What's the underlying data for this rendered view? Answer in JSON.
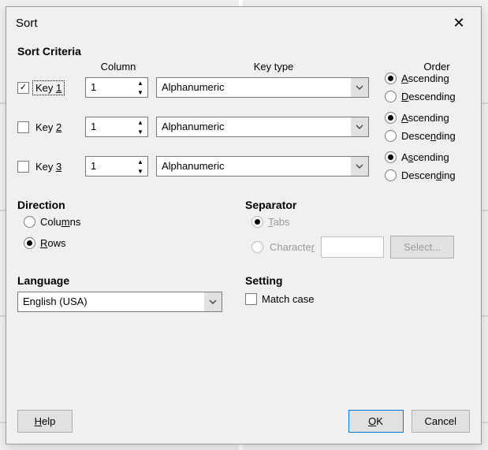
{
  "title": "Sort",
  "criteria": {
    "heading": "Sort Criteria",
    "headers": {
      "column": "Column",
      "keytype": "Key type",
      "order": "Order"
    },
    "keys": [
      {
        "label_pre": "Key ",
        "label_u": "1",
        "label_post": "",
        "checked": true,
        "column": "1",
        "keytype": "Alphanumeric"
      },
      {
        "label_pre": "Key ",
        "label_u": "2",
        "label_post": "",
        "checked": false,
        "column": "1",
        "keytype": "Alphanumeric"
      },
      {
        "label_pre": "Key ",
        "label_u": "3",
        "label_post": "",
        "checked": false,
        "column": "1",
        "keytype": "Alphanumeric"
      }
    ],
    "order": {
      "asc_pre": "",
      "asc_u": "A",
      "asc_post": "scending",
      "desc_pre": "",
      "desc_u": "D",
      "desc_post": "escending",
      "asc2_pre": "",
      "asc2_u": "A",
      "asc2_post": "scending",
      "desc2_pre": "Desce",
      "desc2_u": "n",
      "desc2_post": "ding",
      "asc3_pre": "A",
      "asc3_u": "s",
      "asc3_post": "cending",
      "desc3_pre": "Descen",
      "desc3_u": "d",
      "desc3_post": "ing"
    }
  },
  "direction": {
    "heading": "Direction",
    "columns_pre": "Colu",
    "columns_u": "m",
    "columns_post": "ns",
    "rows_pre": "",
    "rows_u": "R",
    "rows_post": "ows"
  },
  "separator": {
    "heading": "Separator",
    "tabs_pre": "",
    "tabs_u": "T",
    "tabs_post": "abs",
    "char_pre": "Characte",
    "char_u": "r",
    "char_post": "",
    "select": "Select..."
  },
  "language": {
    "heading": "Language",
    "value": "English (USA)"
  },
  "setting": {
    "heading": "Setting",
    "match": "Match case"
  },
  "footer": {
    "help_pre": "",
    "help_u": "H",
    "help_post": "elp",
    "ok_pre": "",
    "ok_u": "O",
    "ok_post": "K",
    "cancel": "Cancel"
  }
}
